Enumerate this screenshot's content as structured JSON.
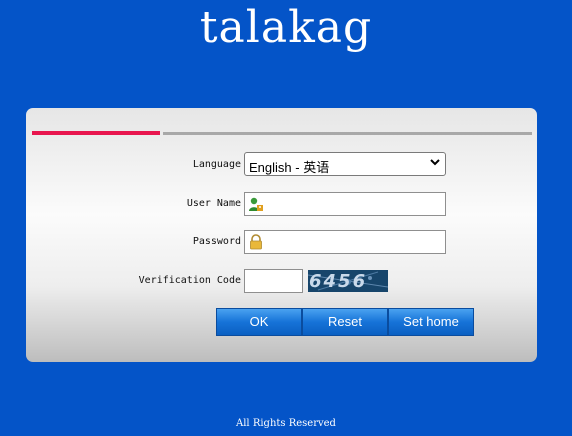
{
  "brand": "talakag",
  "form": {
    "language_label": "Language",
    "language_value": "English - 英语",
    "username_label": "User Name",
    "password_label": "Password",
    "verification_label": "Verification Code",
    "captcha_text": "6456",
    "username_icon": "user-icon",
    "password_icon": "lock-icon"
  },
  "buttons": {
    "ok": "OK",
    "reset": "Reset",
    "sethome": "Set home"
  },
  "footer": "All Rights Reserved",
  "colors": {
    "background": "#0454c8",
    "accent_bar": "#e8164e",
    "button": "#1673d8"
  }
}
